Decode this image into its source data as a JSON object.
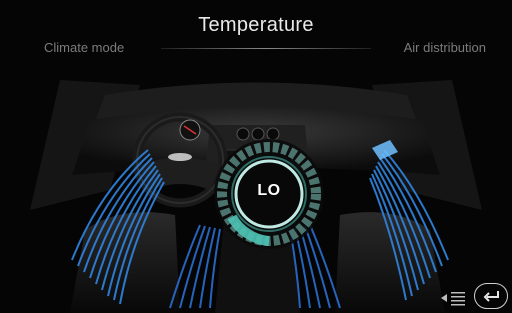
{
  "header": {
    "title": "Temperature",
    "left_tab": "Climate mode",
    "right_tab": "Air distribution"
  },
  "dial": {
    "value": "LO"
  },
  "controls": {
    "list_icon": "list-icon",
    "back_icon": "back-icon"
  },
  "colors": {
    "airflow": "#2f7fd6",
    "airflow_light": "#8fd0ff",
    "dial_teal": "#4cc3b5",
    "background": "#050505"
  }
}
